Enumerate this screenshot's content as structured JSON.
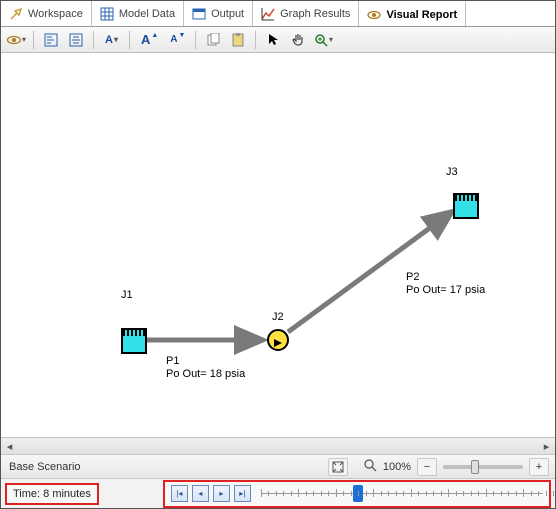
{
  "tabs": [
    {
      "label": "Workspace",
      "icon": "wrench"
    },
    {
      "label": "Model Data",
      "icon": "grid"
    },
    {
      "label": "Output",
      "icon": "output"
    },
    {
      "label": "Graph Results",
      "icon": "graph"
    },
    {
      "label": "Visual Report",
      "icon": "eye",
      "active": true
    }
  ],
  "toolbar": {
    "a_single": "A",
    "a_plus": "A",
    "a_minus": "A"
  },
  "diagram": {
    "junctions": {
      "j1": "J1",
      "j2": "J2",
      "j3": "J3"
    },
    "pipes": {
      "p1": {
        "name": "P1",
        "prop": "Po Out= 18 psia"
      },
      "p2": {
        "name": "P2",
        "prop": "Po Out= 17 psia"
      }
    }
  },
  "status": {
    "scenario": "Base Scenario",
    "zoom": "100%"
  },
  "timebar": {
    "label": "Time: 8 minutes"
  }
}
